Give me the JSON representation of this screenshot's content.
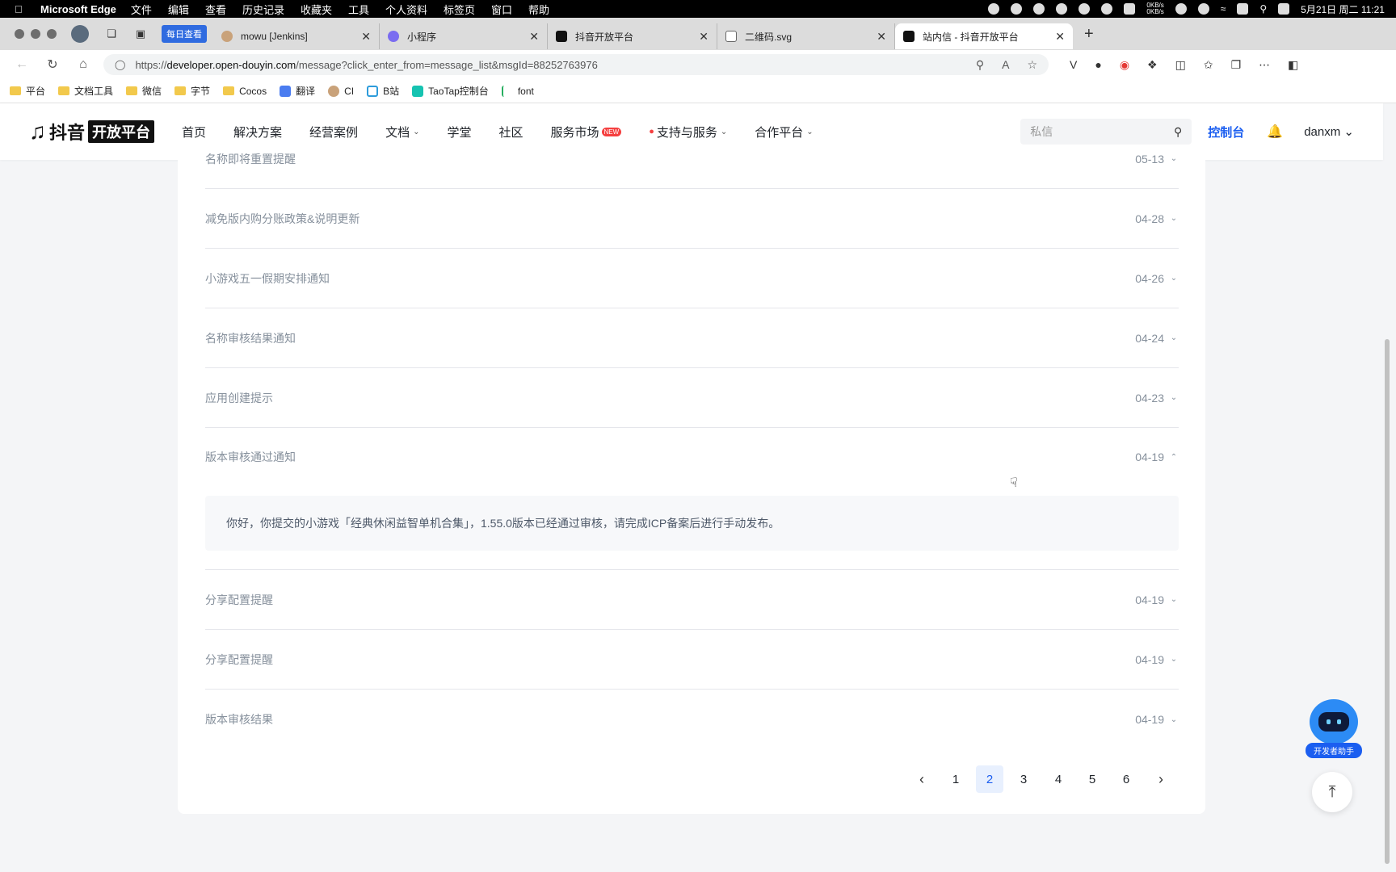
{
  "menubar": {
    "app": "Microsoft Edge",
    "menus": [
      "文件",
      "编辑",
      "查看",
      "历史记录",
      "收藏夹",
      "工具",
      "个人资料",
      "标签页",
      "窗口",
      "帮助"
    ],
    "net_up": "0KB/s",
    "net_down": "0KB/s",
    "datetime": "5月21日 周二 11:21"
  },
  "browser": {
    "daily_label": "每日查看",
    "tabs": [
      {
        "title": "mowu [Jenkins]",
        "active": false
      },
      {
        "title": "小程序",
        "active": false
      },
      {
        "title": "抖音开放平台",
        "active": false
      },
      {
        "title": "二维码.svg",
        "active": false
      },
      {
        "title": "站内信 - 抖音开放平台",
        "active": true
      }
    ],
    "url_prefix": "https://",
    "url_host": "developer.open-douyin.com",
    "url_path": "/message?click_enter_from=message_list&msgId=88252763976"
  },
  "bookmarks": [
    "平台",
    "文档工具",
    "微信",
    "字节",
    "Cocos",
    "翻译",
    "CI",
    "B站",
    "TaoTap控制台",
    "font"
  ],
  "site": {
    "logo_name": "抖音",
    "logo_badge": "开放平台",
    "nav": [
      "首页",
      "解决方案",
      "经营案例",
      "文档",
      "学堂",
      "社区",
      "服务市场",
      "支持与服务",
      "合作平台"
    ],
    "new_badge": "NEW",
    "search_placeholder": "私信",
    "console": "控制台",
    "user": "danxm"
  },
  "messages": [
    {
      "title": "名称即将重置提醒",
      "date": "05-13",
      "expanded": false
    },
    {
      "title": "减免版内购分账政策&说明更新",
      "date": "04-28",
      "expanded": false
    },
    {
      "title": "小游戏五一假期安排通知",
      "date": "04-26",
      "expanded": false
    },
    {
      "title": "名称审核结果通知",
      "date": "04-24",
      "expanded": false
    },
    {
      "title": "应用创建提示",
      "date": "04-23",
      "expanded": false
    },
    {
      "title": "版本审核通过通知",
      "date": "04-19",
      "expanded": true
    },
    {
      "title": "分享配置提醒",
      "date": "04-19",
      "expanded": false
    },
    {
      "title": "分享配置提醒",
      "date": "04-19",
      "expanded": false
    },
    {
      "title": "版本审核结果",
      "date": "04-19",
      "expanded": false
    }
  ],
  "message_detail": "你好，你提交的小游戏「经典休闲益智单机合集」，1.55.0版本已经通过审核，请完成ICP备案后进行手动发布。",
  "pagination": {
    "pages": [
      "1",
      "2",
      "3",
      "4",
      "5",
      "6"
    ],
    "current": "2"
  },
  "assistant_label": "开发者助手",
  "colors": {
    "accent": "#1b5ef0",
    "muted_text": "#86909c",
    "hot": "#f53f3f"
  }
}
